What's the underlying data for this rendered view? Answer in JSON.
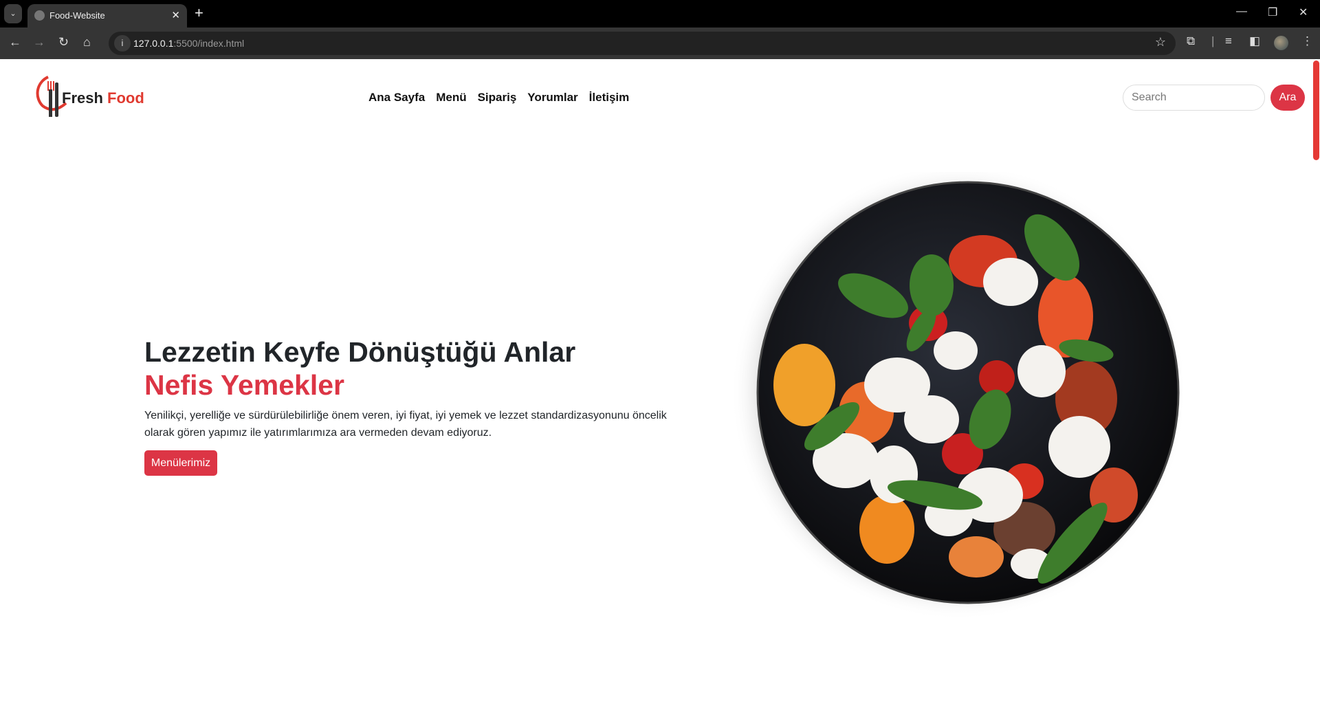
{
  "browser": {
    "tab_title": "Food-Website",
    "url_host": "127.0.0.1",
    "url_path": ":5500/index.html",
    "icons": [
      "tab-list-icon",
      "globe-icon",
      "close-icon",
      "plus-icon",
      "minimize-icon",
      "restore-icon",
      "close-window-icon",
      "back-icon",
      "forward-icon",
      "reload-icon",
      "home-icon",
      "info-icon",
      "star-icon",
      "extensions-icon",
      "media-icon",
      "sidepanel-icon",
      "profile-avatar",
      "more-icon"
    ]
  },
  "header": {
    "logo_part1": "Fresh",
    "logo_part2": " Food",
    "nav": [
      "Ana Sayfa",
      "Menü",
      "Sipariş",
      "Yorumlar",
      "İletişim"
    ],
    "search_placeholder": "Search",
    "search_button": "Ara"
  },
  "hero": {
    "title": "Lezzetin Keyfe Dönüştüğü Anlar",
    "subtitle": "Nefis Yemekler",
    "text": "Yenilikçi, yerelliğe ve sürdürülebilirliğe önem veren, iyi fiyat, iyi yemek ve lezzet standardizasyonunu öncelik olarak gören yapımız ile yatırımlarımıza ara vermeden devam ediyoruz.",
    "button": "Menülerimiz"
  },
  "colors": {
    "accent": "#dc3545",
    "logo_red": "#e03a30",
    "text": "#212529"
  }
}
